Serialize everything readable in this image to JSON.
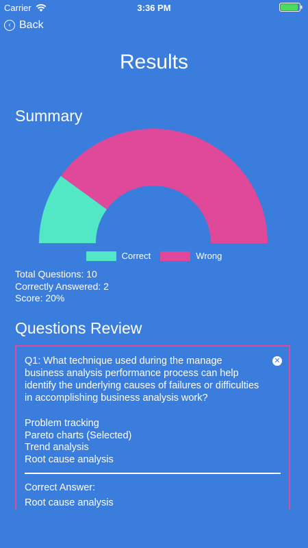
{
  "status_bar": {
    "carrier": "Carrier",
    "time": "3:36 PM"
  },
  "nav": {
    "back_label": "Back"
  },
  "page": {
    "title": "Results"
  },
  "summary": {
    "title": "Summary",
    "legend": {
      "correct": "Correct",
      "wrong": "Wrong"
    },
    "total_questions": "Total Questions: 10",
    "correctly_answered": "Correctly Answered: 2",
    "score": "Score: 20%"
  },
  "chart_data": {
    "type": "pie",
    "categories": [
      "Correct",
      "Wrong"
    ],
    "values": [
      2,
      8
    ],
    "colors": [
      "#52e8c6",
      "#e0489a"
    ],
    "style": "half-donut",
    "legend_position": "bottom"
  },
  "review": {
    "title": "Questions Review",
    "questions": [
      {
        "text": "Q1: What technique used during the manage business analysis performance process can help identify the underlying causes of failures or difficulties in accomplishing business analysis work?",
        "options": [
          "Problem tracking",
          "Pareto charts (Selected)",
          "Trend analysis",
          "Root cause analysis"
        ],
        "correct_label": "Correct Answer:",
        "correct_answer": "Root cause analysis"
      }
    ]
  },
  "colors": {
    "background": "#3b7ddd",
    "correct": "#52e8c6",
    "wrong": "#e0489a"
  }
}
